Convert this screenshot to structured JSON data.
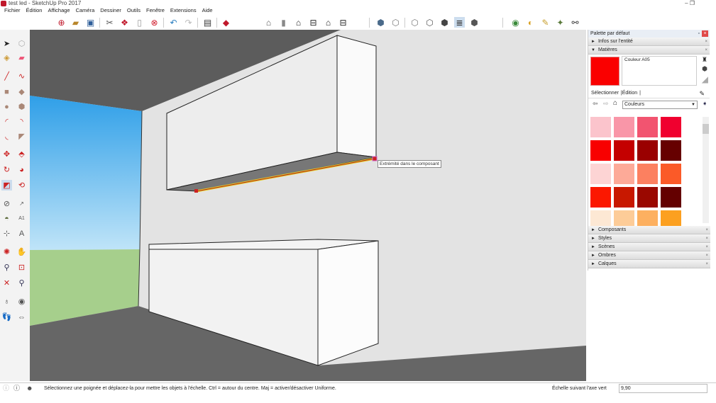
{
  "window": {
    "title": "test led - SketchUp Pro 2017",
    "controls": "–  ❐"
  },
  "menu": [
    "Fichier",
    "Édition",
    "Affichage",
    "Caméra",
    "Dessiner",
    "Outils",
    "Fenêtre",
    "Extensions",
    "Aide"
  ],
  "toolbar_icons": [
    "new-icon",
    "open-icon",
    "save-icon",
    "cut-icon",
    "copy-icon",
    "paste-icon",
    "erase-icon",
    "undo-icon",
    "redo-icon",
    "print-icon",
    "model-info-icon",
    "iso-view-icon",
    "top-view-icon",
    "front-view-icon",
    "right-view-icon",
    "back-view-icon",
    "left-view-icon",
    "xray-icon",
    "wireframe-icon",
    "hidden-line-icon",
    "shaded-icon",
    "shaded-texture-icon",
    "monochrome-icon",
    "geolocation-icon",
    "3d-warehouse-icon",
    "extension-warehouse-icon",
    "layout-icon",
    "binoculars-icon"
  ],
  "viewport": {
    "tooltip": "Extrémité dans le composant"
  },
  "panel": {
    "title": "Palette par défaut",
    "sections_top": [
      {
        "label": "Infos sur l'entité",
        "expanded": false
      },
      {
        "label": "Matières",
        "expanded": true
      }
    ],
    "material_name": "Couleur A05",
    "material_color": "#fa0000",
    "tabs": [
      "Sélectionner",
      "Édition"
    ],
    "collection": "Couleurs",
    "swatches": [
      "#fbc4cc",
      "#f996a8",
      "#f25470",
      "#f0002f",
      "#f80000",
      "#c40000",
      "#9a0000",
      "#660000",
      "#fdd4d4",
      "#fdaa98",
      "#fc8060",
      "#fb5a28",
      "#fb1800",
      "#c81800",
      "#9a0800",
      "#640000",
      "#fde8d4",
      "#fdcc98",
      "#fdb060",
      "#fca020"
    ],
    "sections_bottom": [
      "Composants",
      "Styles",
      "Scènes",
      "Ombres",
      "Calques"
    ]
  },
  "status": {
    "message": "Sélectionnez une poignée et déplacez-la pour mettre les objets à l'échelle. Ctrl = autour du centre. Maj = activer/désactiver Uniforme.",
    "measure_label": "Échelle suivant l'axe vert",
    "measure_value": "9,90"
  }
}
